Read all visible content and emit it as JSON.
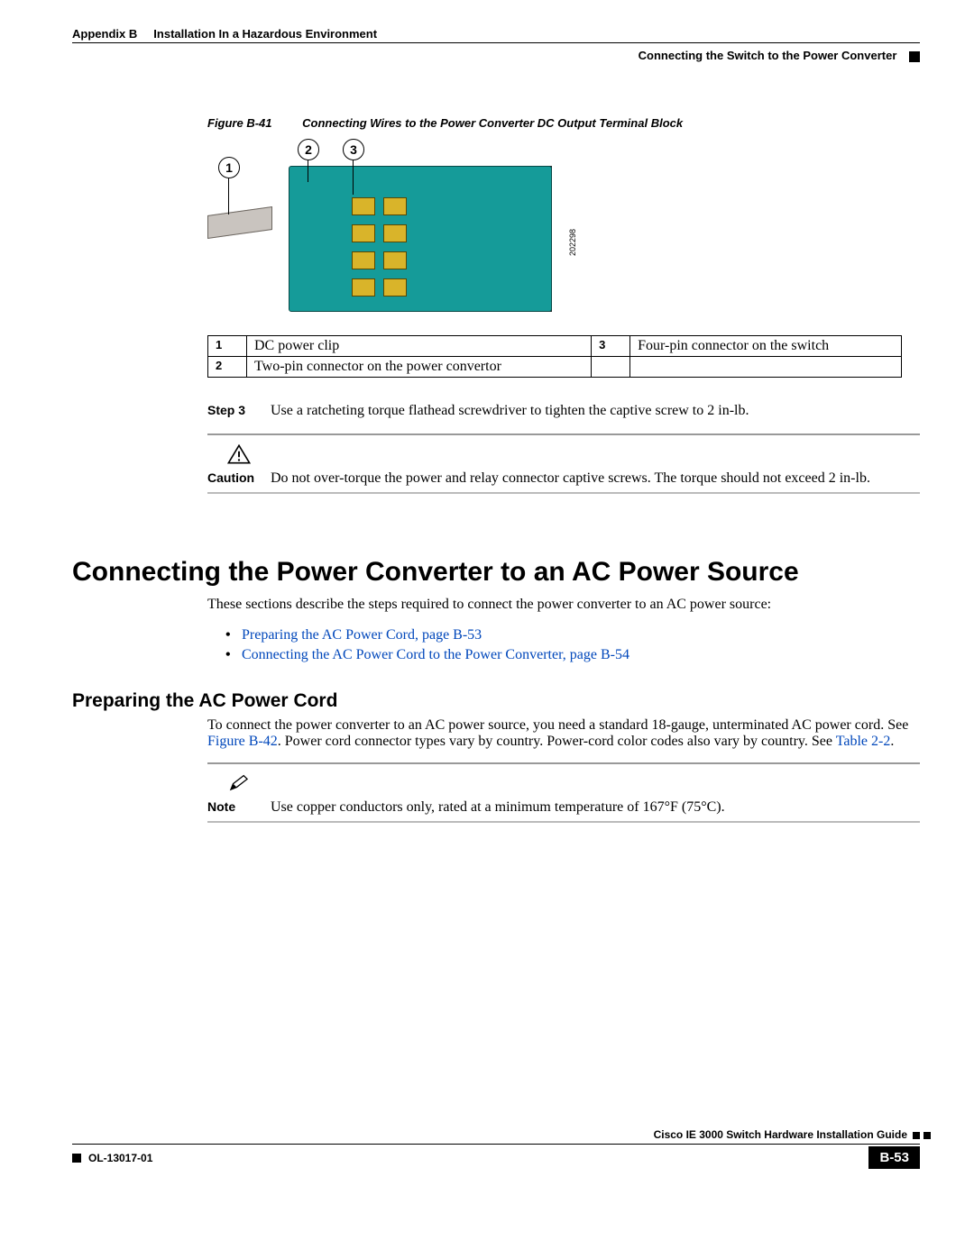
{
  "header": {
    "appendix_label": "Appendix B",
    "appendix_title": "Installation In a Hazardous Environment",
    "section_right": "Connecting the Switch to the Power Converter"
  },
  "figure": {
    "label": "Figure B-41",
    "title": "Connecting Wires to the Power Converter DC Output Terminal Block",
    "image_id": "202298",
    "callouts": {
      "c1": "1",
      "c2": "2",
      "c3": "3"
    }
  },
  "parts_table": {
    "r1n": "1",
    "r1t": "DC power clip",
    "r1n2": "3",
    "r1t2": "Four-pin connector on the switch",
    "r2n": "2",
    "r2t": "Two-pin connector on the power convertor",
    "r2n2": "",
    "r2t2": ""
  },
  "step": {
    "label": "Step 3",
    "text": "Use a ratcheting torque flathead screwdriver to tighten the captive screw to 2 in-lb."
  },
  "caution": {
    "label": "Caution",
    "text": "Do not over-torque the power and relay connector captive screws. The torque should not exceed 2 in-lb."
  },
  "h1": "Connecting the Power Converter to an AC Power Source",
  "intro_para": "These sections describe the steps required to connect the power converter to an AC power source:",
  "bullets": {
    "b1": "Preparing the AC Power Cord, page B-53",
    "b2": "Connecting the AC Power Cord to the Power Converter, page B-54"
  },
  "h2": "Preparing the AC Power Cord",
  "prep_para_a": "To connect the power converter to an AC power source, you need a standard 18-gauge, unterminated AC power cord. See ",
  "prep_xref1": "Figure B-42",
  "prep_para_b": ". Power cord connector types vary by country. Power-cord color codes also vary by country. See ",
  "prep_xref2": "Table 2-2",
  "prep_para_c": ".",
  "note": {
    "label": "Note",
    "text": "Use copper conductors only, rated at a minimum temperature of 167°F (75°C)."
  },
  "footer": {
    "book_title": "Cisco IE 3000 Switch Hardware Installation Guide",
    "doc_id": "OL-13017-01",
    "page_num": "B-53"
  }
}
